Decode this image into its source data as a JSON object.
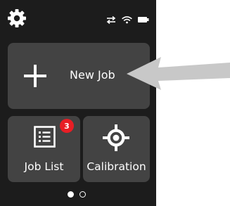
{
  "status_bar": {
    "settings_icon": "gear-icon",
    "icons": [
      "transfer-arrows-icon",
      "wifi-icon",
      "battery-icon"
    ]
  },
  "tiles": {
    "new_job": {
      "label": "New Job",
      "icon": "plus-icon"
    },
    "job_list": {
      "label": "Job List",
      "icon": "list-icon",
      "badge": "3"
    },
    "calibration": {
      "label": "Calibration",
      "icon": "target-icon"
    }
  },
  "pager": {
    "pages": 2,
    "current": 1
  },
  "colors": {
    "background": "#1c1c1c",
    "tile": "#434343",
    "badge": "#e81e25",
    "callout_arrow": "#c8c8c8"
  }
}
